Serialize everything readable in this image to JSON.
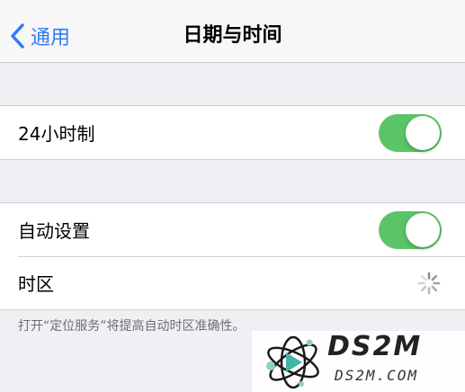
{
  "nav": {
    "back_label": "通用",
    "title": "日期与时间"
  },
  "settings": {
    "hour24": {
      "label": "24小时制",
      "on": true
    },
    "auto_set": {
      "label": "自动设置",
      "on": true
    },
    "timezone": {
      "label": "时区"
    },
    "footer": "打开“定位服务”将提高自动时区准确性。"
  },
  "watermark": {
    "brand": "DS2M",
    "site": "DS2M.COM"
  },
  "colors": {
    "accent": "#2f7cf6",
    "toggle_on": "#5ac467",
    "background": "#efeff4"
  }
}
